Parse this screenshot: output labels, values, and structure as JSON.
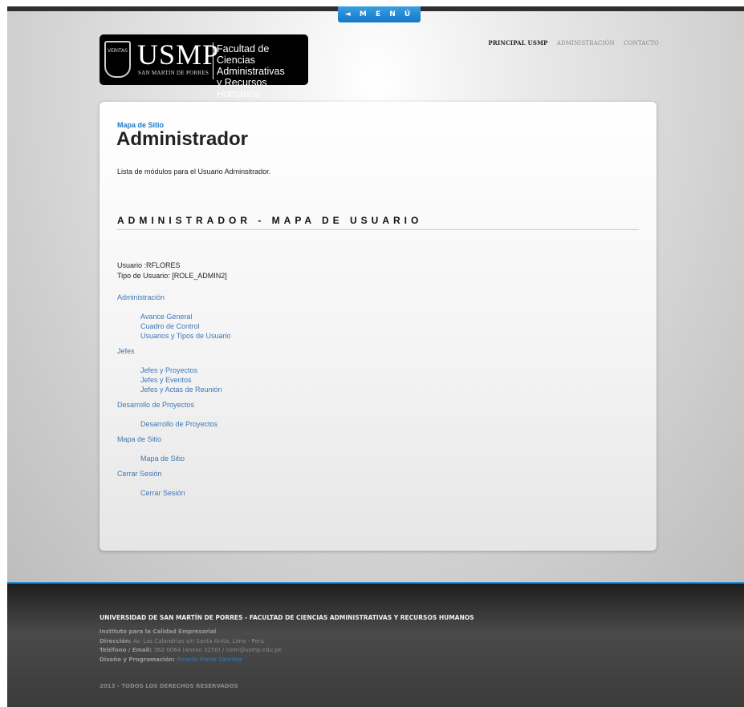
{
  "menu": {
    "label": "◄ M E N Ú ►"
  },
  "logo": {
    "crest_text": "VERITAS",
    "brand": "USMP",
    "brand_sub": "SAN MARTIN DE PORRES",
    "faculty_line1": "Facultad de",
    "faculty_line2": "Ciencias Administrativas",
    "faculty_line3": "y Recursos Humanos"
  },
  "nav": {
    "items": [
      {
        "label": "PRINCIPAL USMP"
      },
      {
        "label": "ADMINISTRACIÓN"
      },
      {
        "label": "CONTACTO"
      }
    ]
  },
  "page": {
    "breadcrumb": "Mapa de Sitio",
    "title": "Administrador",
    "lead": "Lista de módulos para el Usuario Adminsitrador.",
    "section_title": "ADMINISTRADOR - MAPA DE USUARIO"
  },
  "user": {
    "username_line": "Usuario :RFLORES",
    "role_line": "Tipo de Usuario: [ROLE_ADMIN2]"
  },
  "sitemap": [
    {
      "heading": "Administración",
      "items": [
        "Avance General",
        "Cuadro de Control",
        "Usuarios y Tipos de Usuario"
      ]
    },
    {
      "heading": "Jefes",
      "items": [
        "Jefes y Proyectos",
        "Jefes y Eventos",
        "Jefes y Actas de Reunión"
      ]
    },
    {
      "heading": "Desarrollo de Proyectos",
      "items": [
        "Desarrollo de Proyectos"
      ]
    },
    {
      "heading": "Mapa de Sitio",
      "items": [
        "Mapa de Sitio"
      ]
    },
    {
      "heading": "Cerrar Sesión",
      "items": [
        "Cerrar Sesión"
      ]
    }
  ],
  "footer": {
    "title": "UNIVERSIDAD DE SAN MARTÍN DE PORRES - FACULTAD DE CIENCIAS ADMINISTRATIVAS Y RECURSOS HUMANOS",
    "institute": "Instituto para la Calidad Empresarial",
    "address_label": "Dirección:",
    "address": "Av. Las Calandrias s/n Santa Anita, Lima - Perú",
    "contact_label": "Teléfono / Email:",
    "contact": "362-0064 (Anexo 3250) / icem@usmp.edu.pe",
    "design_label": "Diseño y Programación:",
    "designer": "Ricardo Flores Sánchez",
    "copyright": "2013 - TODOS LOS DERECHOS RESERVADOS"
  },
  "colors": {
    "accent": "#1b79c8",
    "link": "#3f77b5",
    "footer_bg": "#3b3b3b"
  }
}
